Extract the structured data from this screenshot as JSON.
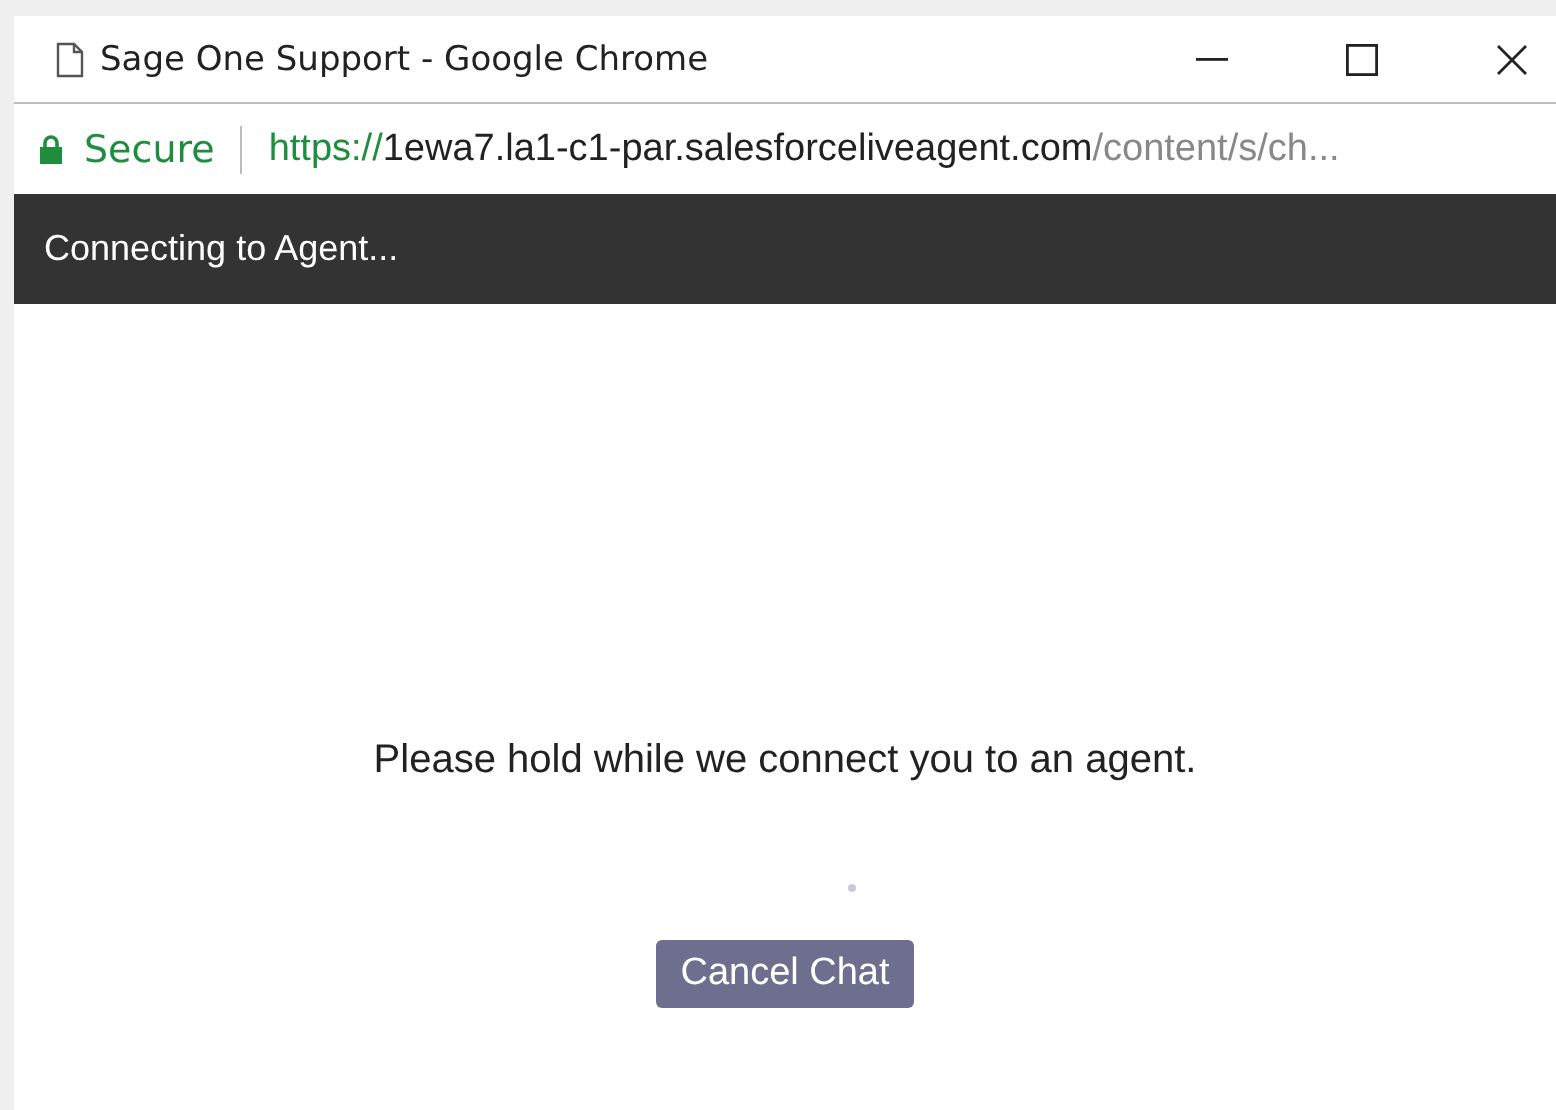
{
  "window": {
    "title": "Sage One Support - Google Chrome"
  },
  "address_bar": {
    "secure_label": "Secure",
    "url_scheme": "https://",
    "url_host": "1ewa7.la1-c1-par.salesforceliveagent.com",
    "url_path": "/content/s/ch..."
  },
  "header": {
    "title": "Connecting to Agent..."
  },
  "content": {
    "message": "Please hold while we connect you to an agent.",
    "buttons": [
      "Cancel Chat"
    ]
  }
}
